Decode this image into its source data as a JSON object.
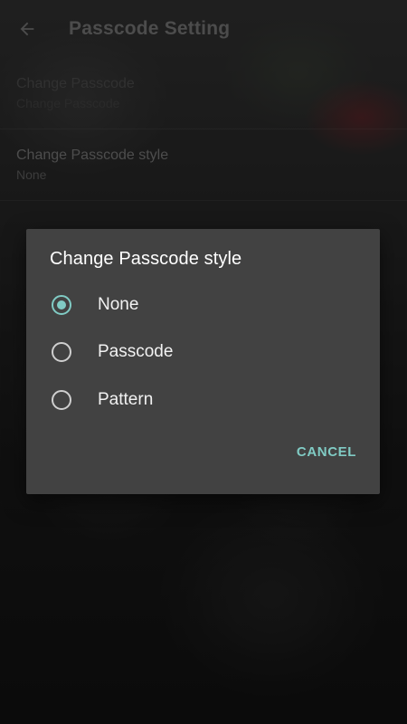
{
  "toolbar": {
    "title": "Passcode Setting",
    "back_icon": "arrow-left-icon"
  },
  "preferences": [
    {
      "title": "Change Passcode",
      "summary": "Change Passcode",
      "enabled": false
    },
    {
      "title": "Change Passcode style",
      "summary": "None",
      "enabled": true
    }
  ],
  "dialog": {
    "title": "Change Passcode style",
    "options": [
      {
        "label": "None",
        "selected": true
      },
      {
        "label": "Passcode",
        "selected": false
      },
      {
        "label": "Pattern",
        "selected": false
      }
    ],
    "cancel_label": "CANCEL"
  },
  "colors": {
    "accent": "#80cbc4",
    "dialog_bg": "#424242"
  }
}
